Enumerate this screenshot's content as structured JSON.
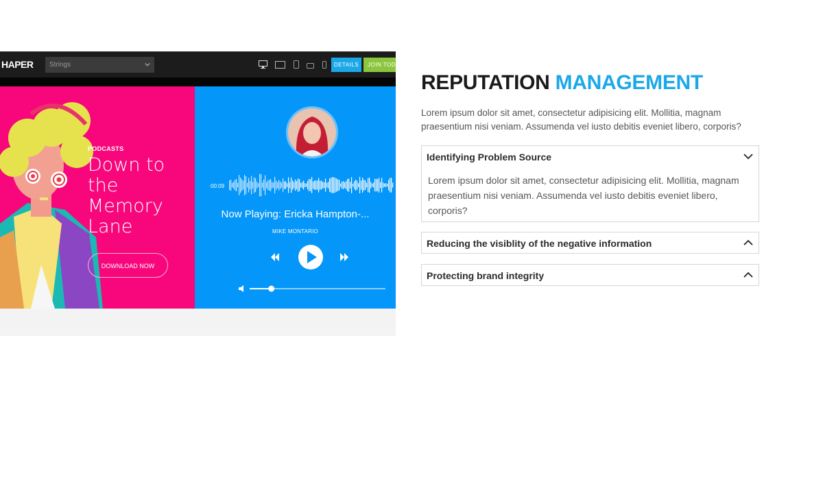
{
  "preview": {
    "brand": "HAPER",
    "select_value": "Strings",
    "details_label": "DETAILS",
    "join_label": "JOIN TODAY",
    "podcast_tag": "PODCASTS",
    "headline": "Down to the Memory Lane",
    "download_label": "DOWNLOAD NOW",
    "player": {
      "time": "00:09",
      "now_playing": "Now Playing: Ericka Hampton-...",
      "artist": "MIKE MONTARIO",
      "volume_level": 0.16
    },
    "icons": [
      "desktop-icon",
      "laptop-icon",
      "tablet-icon",
      "tablet-landscape-icon",
      "phone-icon",
      "chevron-down-icon",
      "rewind-icon",
      "play-icon",
      "forward-icon",
      "volume-icon"
    ]
  },
  "content": {
    "title_main": "REPUTATION",
    "title_accent": "MANAGEMENT",
    "intro": "Lorem ipsum dolor sit amet, consectetur adipisicing elit. Mollitia, magnam praesentium nisi veniam. Assumenda vel iusto debitis eveniet libero, corporis?",
    "accordion": [
      {
        "title": "Identifying Problem Source",
        "expanded": true,
        "body": "Lorem ipsum dolor sit amet, consectetur adipisicing elit. Mollitia, magnam praesentium nisi veniam. Assumenda vel iusto debitis eveniet libero, corporis?"
      },
      {
        "title": "Reducing the visiblity of the negative information",
        "expanded": false
      },
      {
        "title": "Protecting brand integrity",
        "expanded": false
      }
    ]
  },
  "colors": {
    "accent": "#1ca8e8",
    "pink": "#f7077b",
    "blue": "#0496f9",
    "join_green": "#8cc63e"
  }
}
